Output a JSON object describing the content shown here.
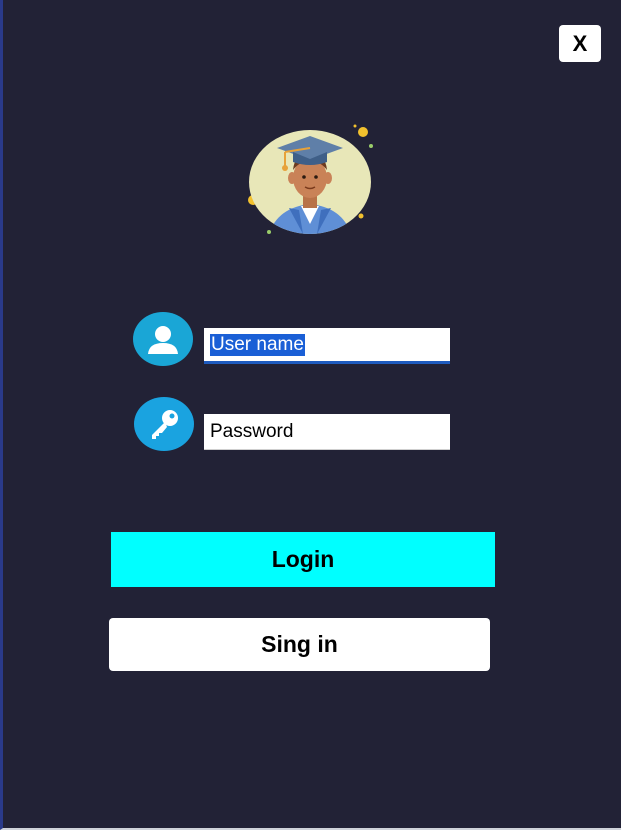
{
  "window": {
    "close_label": "X"
  },
  "login_form": {
    "username_value": "User name",
    "password_value": "Password",
    "login_label": "Login",
    "signin_label": "Sing in"
  },
  "colors": {
    "background": "#222236",
    "login_button": "#00ffff",
    "icon_circle": "#1aa6d6",
    "selection_highlight": "#1a5fd6"
  },
  "icons": {
    "avatar": "graduate-avatar-icon",
    "username": "user-icon",
    "password": "key-icon"
  }
}
